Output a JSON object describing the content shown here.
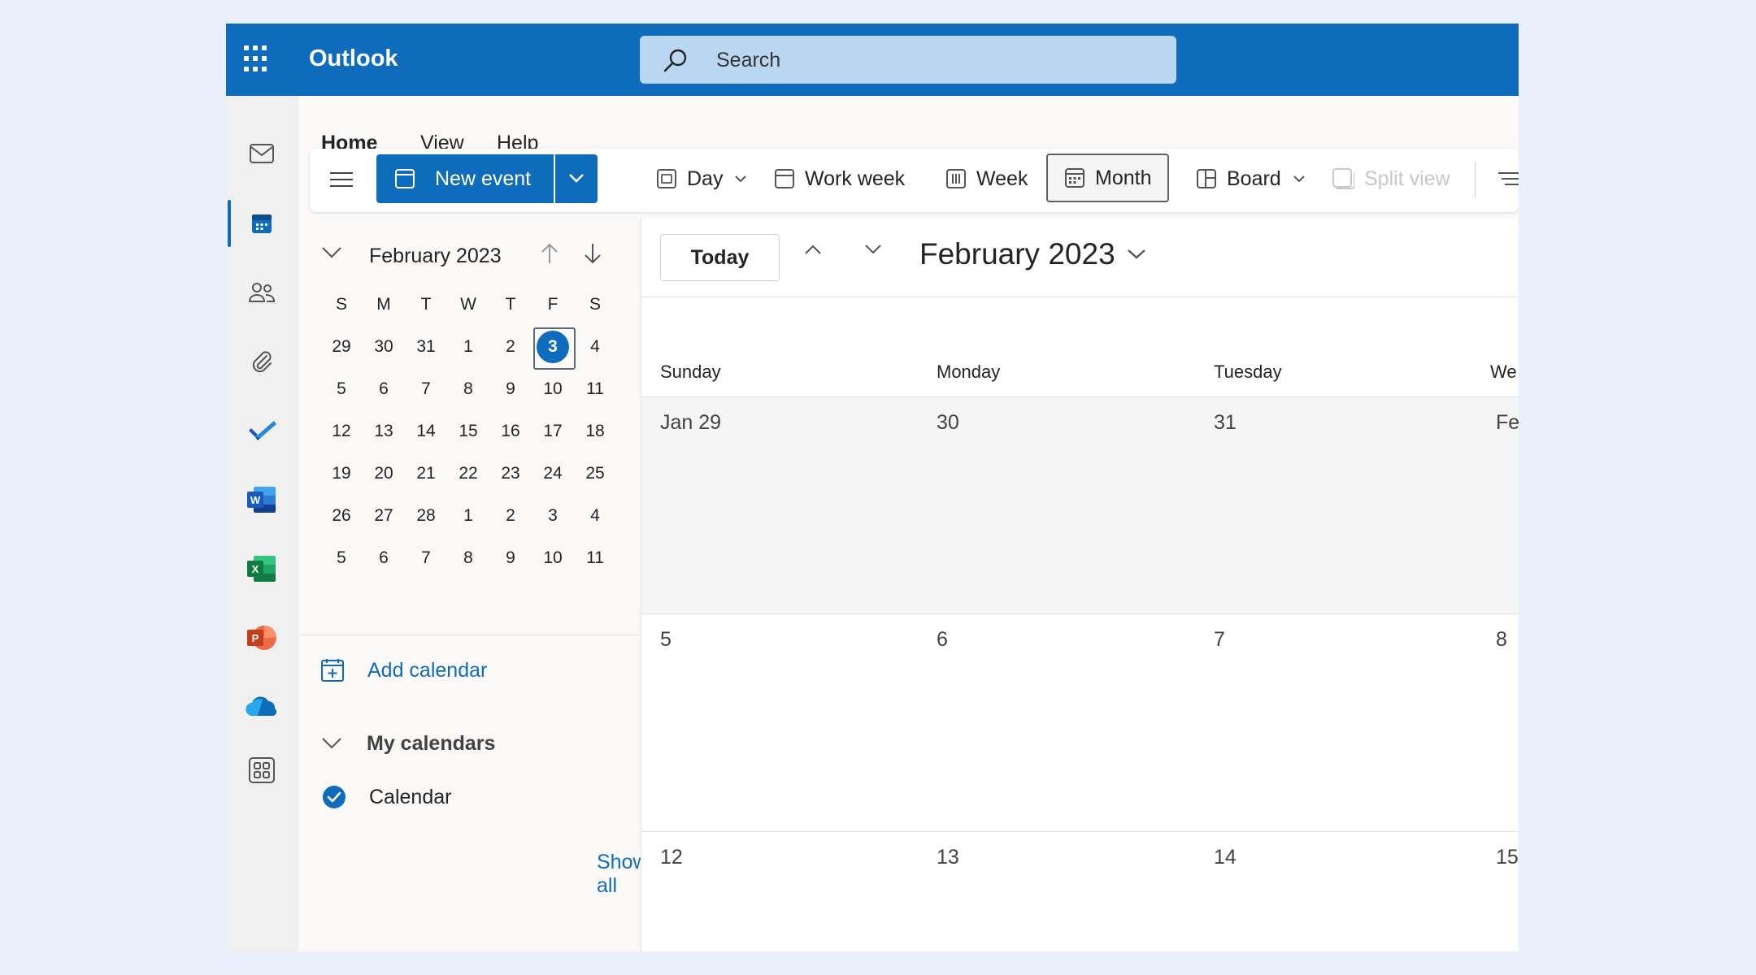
{
  "app": {
    "title": "Outlook"
  },
  "search": {
    "placeholder": "Search"
  },
  "ribbon": {
    "tabs": [
      "Home",
      "View",
      "Help"
    ],
    "new_event": "New event",
    "views": {
      "day": "Day",
      "work_week": "Work week",
      "week": "Week",
      "month": "Month",
      "board": "Board",
      "split_view": "Split view"
    }
  },
  "rail": {
    "icons": [
      "mail-icon",
      "calendar-icon",
      "people-icon",
      "attachment-icon",
      "todo-icon",
      "word-icon",
      "excel-icon",
      "powerpoint-icon",
      "onedrive-icon",
      "more-apps-icon"
    ],
    "active": "calendar-icon"
  },
  "mini_calendar": {
    "title": "February 2023",
    "days_of_week": [
      "S",
      "M",
      "T",
      "W",
      "T",
      "F",
      "S"
    ],
    "weeks": [
      [
        "29",
        "30",
        "31",
        "1",
        "2",
        "3",
        "4"
      ],
      [
        "5",
        "6",
        "7",
        "8",
        "9",
        "10",
        "11"
      ],
      [
        "12",
        "13",
        "14",
        "15",
        "16",
        "17",
        "18"
      ],
      [
        "19",
        "20",
        "21",
        "22",
        "23",
        "24",
        "25"
      ],
      [
        "26",
        "27",
        "28",
        "1",
        "2",
        "3",
        "4"
      ],
      [
        "5",
        "6",
        "7",
        "8",
        "9",
        "10",
        "11"
      ]
    ],
    "selected": "3"
  },
  "calendars": {
    "add_calendar": "Add calendar",
    "my_calendars": "My calendars",
    "items": [
      {
        "name": "Calendar",
        "checked": true,
        "color": "#0f6cbd"
      }
    ],
    "show_all": "Show all"
  },
  "month_view": {
    "today_button": "Today",
    "title": "February 2023",
    "day_headers": [
      "Sunday",
      "Monday",
      "Tuesday",
      "We"
    ],
    "weeks": [
      [
        "Jan 29",
        "30",
        "31",
        "Fe"
      ],
      [
        "5",
        "6",
        "7",
        "8"
      ],
      [
        "12",
        "13",
        "14",
        "15"
      ]
    ]
  },
  "colors": {
    "brand": "#0f6cbd",
    "search_bg": "#b9d7f0",
    "page_bg": "#e9f0fb"
  }
}
